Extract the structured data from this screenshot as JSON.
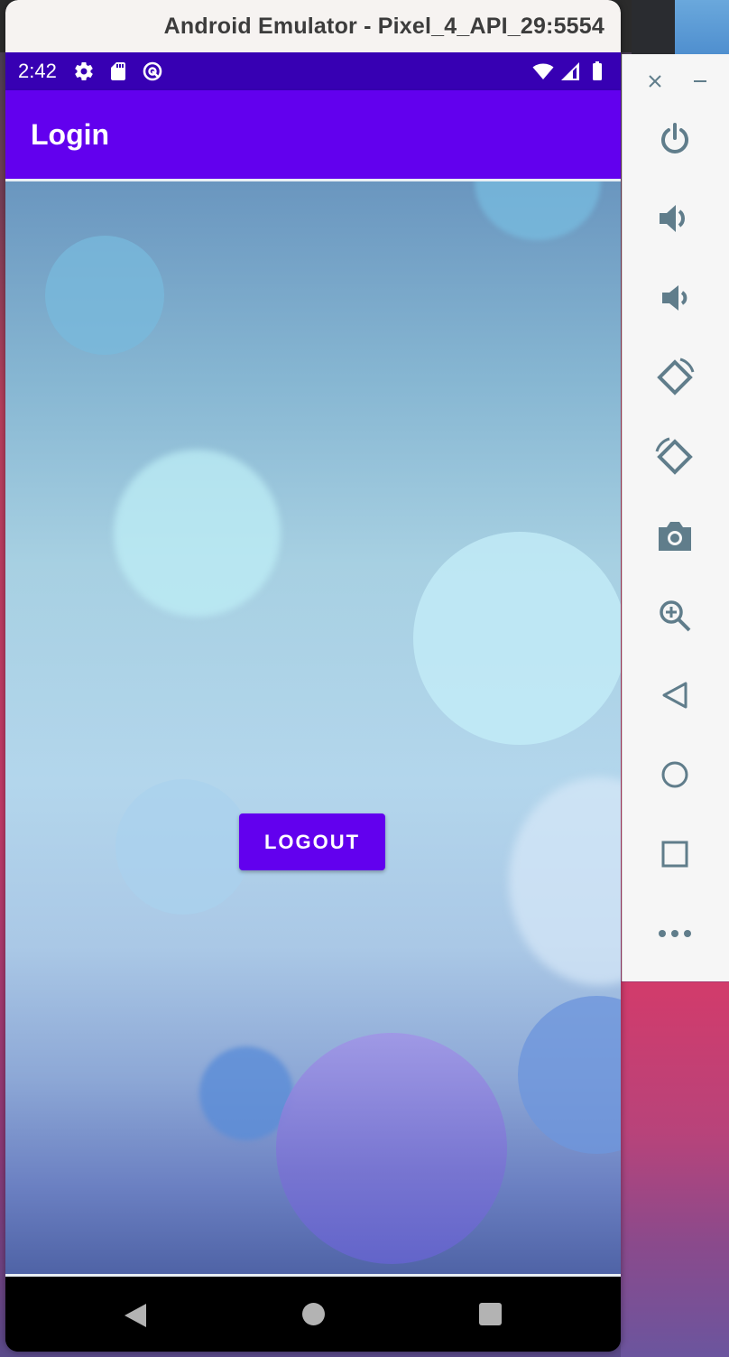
{
  "window": {
    "title": "Android Emulator - Pixel_4_API_29:5554"
  },
  "status_bar": {
    "time": "2:42",
    "left_icons": [
      "gear-icon",
      "sd-card-icon",
      "data-saver-icon"
    ],
    "right_icons": [
      "wifi-icon",
      "signal-icon",
      "battery-icon"
    ]
  },
  "app_bar": {
    "title": "Login"
  },
  "main": {
    "logout_label": "LOGOUT"
  },
  "nav_bar": {
    "buttons": [
      "back",
      "home",
      "recents"
    ]
  },
  "side_toolbar": {
    "items": [
      "close",
      "minimize",
      "power",
      "volume-up",
      "volume-down",
      "rotate-left",
      "rotate-right",
      "screenshot",
      "zoom",
      "back",
      "home",
      "overview",
      "more"
    ]
  },
  "colors": {
    "primary": "#6200ee",
    "primary_dark": "#3700b3",
    "toolbar_icon": "#607d8b"
  }
}
